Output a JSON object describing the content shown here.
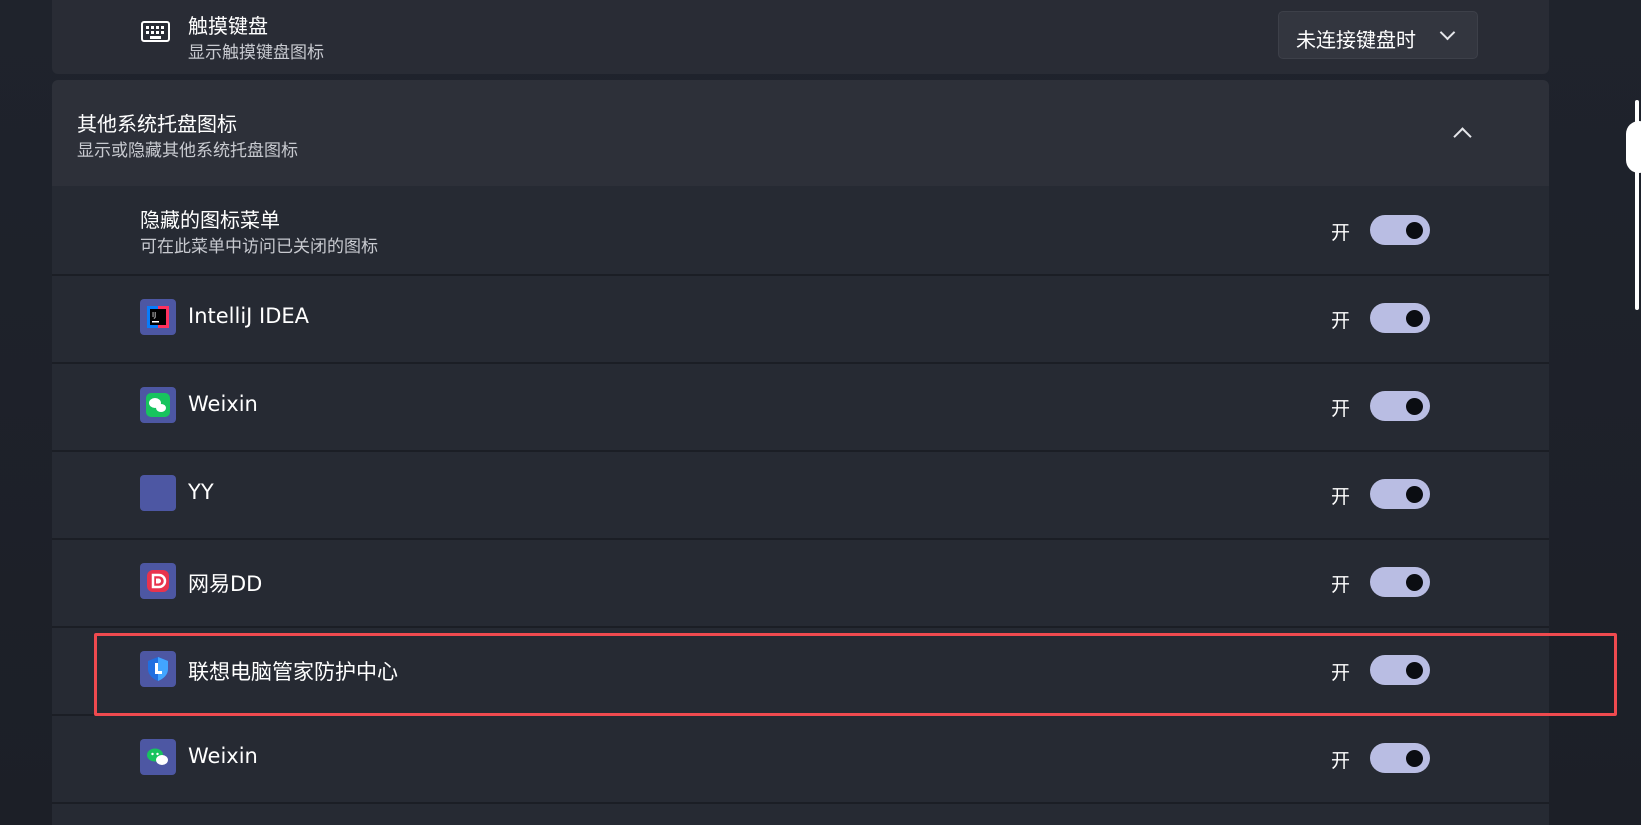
{
  "touch_keyboard": {
    "title": "触摸键盘",
    "subtitle": "显示触摸键盘图标",
    "dropdown_value": "未连接键盘时",
    "icon": "keyboard-icon"
  },
  "other_tray_icons": {
    "title": "其他系统托盘图标",
    "subtitle": "显示或隐藏其他系统托盘图标",
    "expanded": true,
    "toggle_icon": "chevron-up-icon"
  },
  "hidden_icon_menu": {
    "title": "隐藏的图标菜单",
    "subtitle": "可在此菜单中访问已关闭的图标",
    "state_label": "开",
    "is_on": true
  },
  "apps": [
    {
      "label": "IntelliJ IDEA",
      "state_label": "开",
      "is_on": true,
      "icon": "intellij-idea-icon"
    },
    {
      "label": "Weixin",
      "state_label": "开",
      "is_on": true,
      "icon": "weixin-icon"
    },
    {
      "label": "YY",
      "state_label": "开",
      "is_on": true,
      "icon": "yy-icon"
    },
    {
      "label": "网易DD",
      "state_label": "开",
      "is_on": true,
      "icon": "netease-dd-icon"
    },
    {
      "label": "联想电脑管家防护中心",
      "state_label": "开",
      "is_on": true,
      "icon": "lenovo-pc-manager-icon",
      "highlighted": true
    },
    {
      "label": "Weixin",
      "state_label": "开",
      "is_on": true,
      "icon": "weixin-icon"
    }
  ],
  "colors": {
    "toggle_on": "#b9bde3",
    "highlight": "#ef4a4f",
    "app_icon_bg": "#4d57a3"
  }
}
